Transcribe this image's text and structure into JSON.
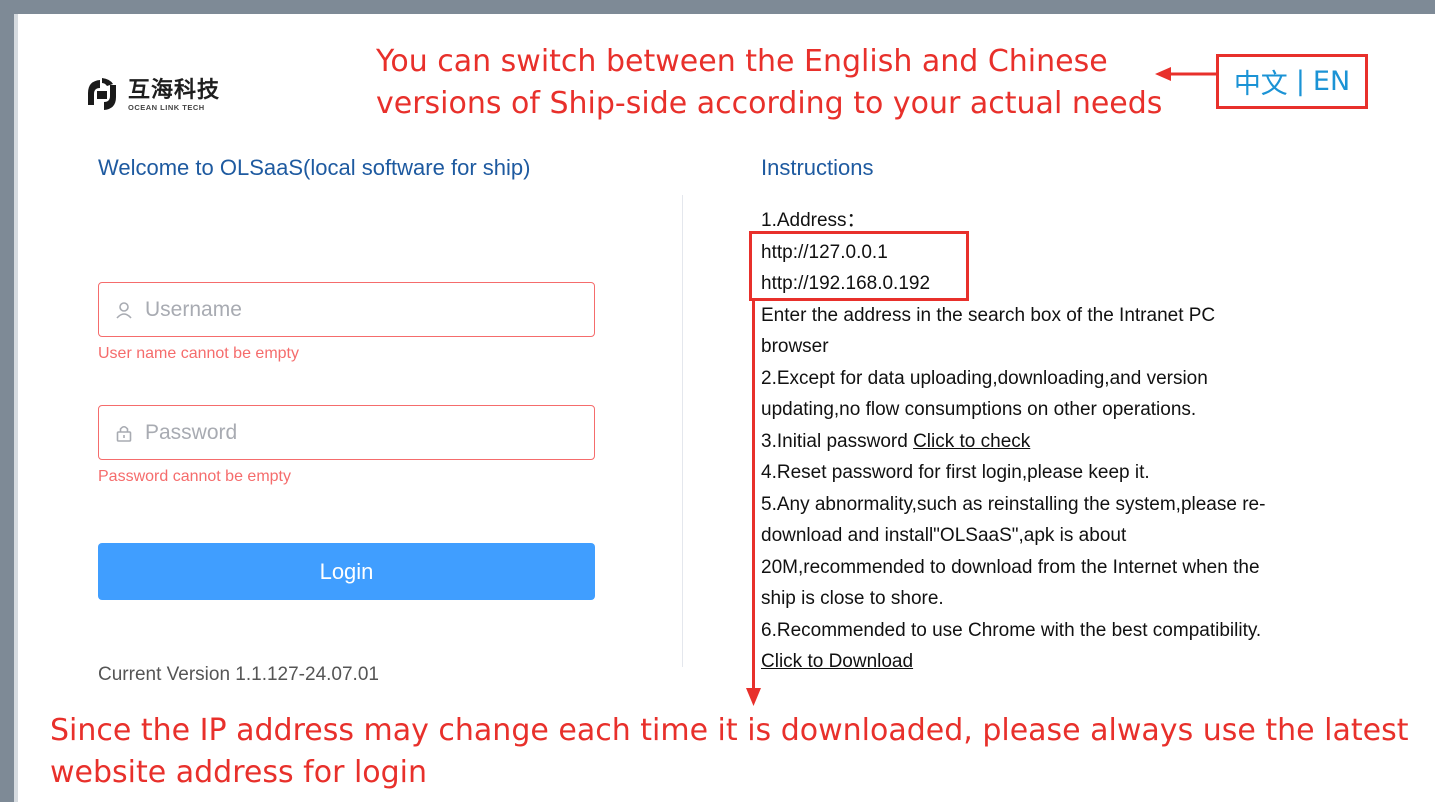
{
  "logo": {
    "cn": "互海科技",
    "en": "OCEAN LINK TECH"
  },
  "annotation_top": {
    "line1": "You can switch between the English and Chinese",
    "line2": "versions of Ship-side according to your actual needs"
  },
  "language": {
    "cn": "中文",
    "separator": "|",
    "en": "EN"
  },
  "login": {
    "welcome": "Welcome to OLSaaS(local software for ship)",
    "username_placeholder": "Username",
    "username_error": "User name cannot be empty",
    "password_placeholder": "Password",
    "password_error": "Password cannot be empty",
    "button": "Login",
    "version": "Current Version 1.1.127-24.07.01"
  },
  "instructions": {
    "title": "Instructions",
    "address_label": "1.Address：",
    "address1": "http://127.0.0.1",
    "address2": "http://192.168.0.192",
    "line_enter1": "Enter the address in the search box of the Intranet PC",
    "line_enter2": "browser",
    "line2a": "2.Except for data uploading,downloading,and version",
    "line2b": "updating,no flow consumptions on other operations.",
    "line3_prefix": "3.Initial password ",
    "line3_link": "Click to check",
    "line4": "4.Reset password for first login,please keep it.",
    "line5a": "5.Any abnormality,such as reinstalling the system,please re-",
    "line5b": "download and install\"OLSaaS\",apk is about",
    "line5c": "20M,recommended to download from the Internet when the",
    "line5d": "ship is close to shore.",
    "line6": "6.Recommended to use Chrome with the best compatibility.",
    "download_link": "Click to Download"
  },
  "annotation_bottom": {
    "line1": "Since the IP address may change each time it is downloaded, please always use the latest",
    "line2": "website address for login"
  },
  "colors": {
    "accent": "#409eff",
    "error": "#f56c6c",
    "annotation": "#e8302b",
    "heading": "#1e5aa0",
    "lang": "#1b93d5"
  }
}
